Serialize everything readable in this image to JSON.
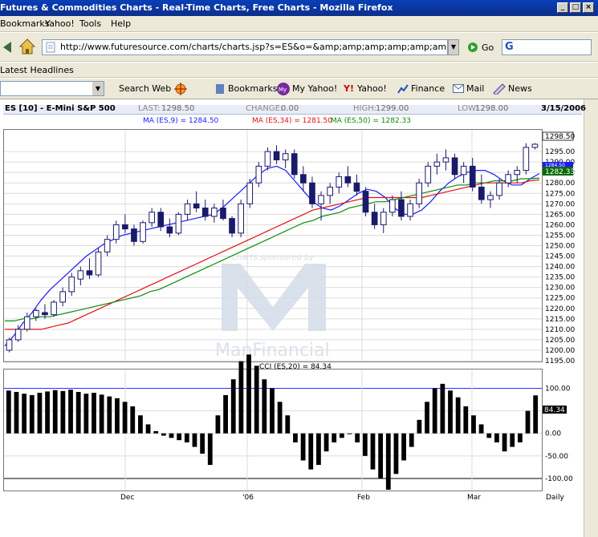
{
  "window": {
    "title": "Futures & Commodities Charts - Real-Time Charts, Free Charts - Mozilla Firefox"
  },
  "menu": [
    "Bookmarks",
    "Yahoo!",
    "Tools",
    "Help"
  ],
  "address": {
    "url": "http://www.futuresource.com/charts/charts.jsp?s=ES&o=&amp;amp;amp;amp;amp;amp;amp;amp;amp;amp;a=D&",
    "go_label": "Go"
  },
  "bookmarks_bar": {
    "item": "Latest Headlines"
  },
  "yahoo_toolbar": {
    "search_web": "Search Web",
    "bookmarks": "Bookmarks",
    "my_yahoo": "My Yahoo!",
    "yahoo": "Yahoo!",
    "finance": "Finance",
    "mail": "Mail",
    "news": "News"
  },
  "chart_header": {
    "symbol": "ES [10] - E-Mini S&P 500",
    "last_label": "LAST:",
    "last": "1298.50",
    "change_label": "CHANGE:",
    "change": "0.00",
    "high_label": "HIGH:",
    "high": "1299.00",
    "low_label": "LOW:",
    "low": "1298.00",
    "date": "3/15/2006"
  },
  "ma_legend": {
    "ma9": "MA (ES,9) = 1284.50",
    "ma34": "MA (ES,34) = 1281.50",
    "ma50": "MA (ES,50) = 1282.33"
  },
  "watermark": {
    "sponsor": "Charts sponsored by",
    "brand": "ManFinancial"
  },
  "cci_label": "CCI (ES,20) = 84.34",
  "price_badges": {
    "last": "1298.50",
    "ma9": "1284.50",
    "ma50": "1282.33"
  },
  "cci_badge": "84.34",
  "bottom_label": "Daily",
  "chart_data": [
    {
      "type": "candlestick",
      "title": "ES [10] - E-Mini S&P 500",
      "x": [
        "Dec",
        "'06",
        "Feb",
        "Mar"
      ],
      "ylim": [
        1195,
        1305
      ],
      "yticks": [
        "1295.00",
        "1290.00",
        "1285.00",
        "1280.00",
        "1275.00",
        "1270.00",
        "1265.00",
        "1260.00",
        "1255.00",
        "1250.00",
        "1245.00",
        "1240.00",
        "1235.00",
        "1230.00",
        "1225.00",
        "1220.00",
        "1215.00",
        "1210.00",
        "1205.00",
        "1200.00",
        "1195.00"
      ],
      "series": [
        {
          "name": "MA (ES,9)",
          "color": "#1a1aff",
          "values": [
            1202,
            1207,
            1213,
            1218,
            1224,
            1229,
            1233,
            1237,
            1241,
            1245,
            1248,
            1251,
            1253,
            1255,
            1256,
            1257,
            1258,
            1259,
            1260,
            1261,
            1262,
            1263,
            1264,
            1265,
            1268,
            1272,
            1276,
            1280,
            1284,
            1287,
            1288,
            1286,
            1281,
            1276,
            1271,
            1268,
            1267,
            1269,
            1272,
            1275,
            1277,
            1276,
            1273,
            1268,
            1265,
            1265,
            1267,
            1271,
            1276,
            1280,
            1283,
            1285,
            1286,
            1286,
            1284,
            1281,
            1279,
            1279,
            1282,
            1284.5
          ]
        },
        {
          "name": "MA (ES,34)",
          "color": "#e01010",
          "values": [
            1210,
            1210,
            1210,
            1210,
            1210,
            1211,
            1212,
            1213,
            1215,
            1217,
            1219,
            1221,
            1223,
            1225,
            1227,
            1229,
            1231,
            1233,
            1235,
            1237,
            1239,
            1241,
            1243,
            1245,
            1247,
            1249,
            1251,
            1253,
            1255,
            1257,
            1259,
            1261,
            1263,
            1265,
            1267,
            1268,
            1269,
            1270,
            1271,
            1272,
            1273,
            1273,
            1273,
            1273,
            1273,
            1273,
            1273,
            1274,
            1275,
            1276,
            1277,
            1278,
            1279,
            1280,
            1280,
            1280,
            1280,
            1280,
            1281,
            1281.5
          ]
        },
        {
          "name": "MA (ES,50)",
          "color": "#0a8a0a",
          "values": [
            1214,
            1214,
            1215,
            1215,
            1216,
            1216,
            1217,
            1218,
            1219,
            1220,
            1221,
            1222,
            1223,
            1224,
            1225,
            1226,
            1228,
            1229,
            1231,
            1233,
            1235,
            1237,
            1239,
            1241,
            1243,
            1245,
            1247,
            1249,
            1251,
            1253,
            1255,
            1257,
            1259,
            1261,
            1262,
            1264,
            1265,
            1266,
            1268,
            1269,
            1270,
            1271,
            1271,
            1272,
            1273,
            1274,
            1275,
            1276,
            1277,
            1278,
            1279,
            1279,
            1280,
            1280,
            1281,
            1281,
            1281,
            1282,
            1282,
            1282.33
          ]
        }
      ],
      "candles": [
        [
          1200,
          1206,
          1199,
          1205
        ],
        [
          1205,
          1212,
          1204,
          1210
        ],
        [
          1210,
          1218,
          1209,
          1216
        ],
        [
          1216,
          1220,
          1214,
          1219
        ],
        [
          1218,
          1222,
          1215,
          1217
        ],
        [
          1217,
          1224,
          1216,
          1223
        ],
        [
          1223,
          1230,
          1221,
          1228
        ],
        [
          1228,
          1237,
          1226,
          1235
        ],
        [
          1234,
          1240,
          1231,
          1238
        ],
        [
          1238,
          1244,
          1234,
          1236
        ],
        [
          1236,
          1249,
          1235,
          1247
        ],
        [
          1247,
          1255,
          1245,
          1253
        ],
        [
          1253,
          1262,
          1251,
          1260
        ],
        [
          1260,
          1265,
          1256,
          1258
        ],
        [
          1258,
          1260,
          1250,
          1252
        ],
        [
          1252,
          1262,
          1251,
          1261
        ],
        [
          1261,
          1268,
          1259,
          1266
        ],
        [
          1266,
          1268,
          1257,
          1259
        ],
        [
          1259,
          1263,
          1254,
          1256
        ],
        [
          1256,
          1266,
          1255,
          1265
        ],
        [
          1265,
          1272,
          1262,
          1270
        ],
        [
          1270,
          1276,
          1266,
          1268
        ],
        [
          1268,
          1272,
          1262,
          1264
        ],
        [
          1264,
          1270,
          1261,
          1268
        ],
        [
          1268,
          1272,
          1262,
          1263
        ],
        [
          1263,
          1264,
          1254,
          1256
        ],
        [
          1256,
          1272,
          1254,
          1270
        ],
        [
          1270,
          1282,
          1268,
          1280
        ],
        [
          1280,
          1290,
          1278,
          1288
        ],
        [
          1288,
          1297,
          1286,
          1295
        ],
        [
          1295,
          1298,
          1289,
          1291
        ],
        [
          1291,
          1296,
          1287,
          1294
        ],
        [
          1294,
          1296,
          1282,
          1284
        ],
        [
          1284,
          1288,
          1276,
          1280
        ],
        [
          1280,
          1283,
          1268,
          1270
        ],
        [
          1270,
          1276,
          1262,
          1274
        ],
        [
          1274,
          1280,
          1270,
          1278
        ],
        [
          1278,
          1285,
          1275,
          1283
        ],
        [
          1283,
          1288,
          1278,
          1280
        ],
        [
          1280,
          1284,
          1274,
          1276
        ],
        [
          1276,
          1278,
          1264,
          1266
        ],
        [
          1266,
          1270,
          1258,
          1260
        ],
        [
          1260,
          1268,
          1256,
          1266
        ],
        [
          1266,
          1274,
          1264,
          1272
        ],
        [
          1272,
          1276,
          1262,
          1264
        ],
        [
          1264,
          1272,
          1262,
          1270
        ],
        [
          1270,
          1282,
          1268,
          1280
        ],
        [
          1280,
          1290,
          1278,
          1288
        ],
        [
          1288,
          1294,
          1284,
          1290
        ],
        [
          1290,
          1296,
          1286,
          1292
        ],
        [
          1292,
          1294,
          1282,
          1284
        ],
        [
          1284,
          1290,
          1280,
          1288
        ],
        [
          1288,
          1292,
          1276,
          1278
        ],
        [
          1278,
          1284,
          1270,
          1272
        ],
        [
          1272,
          1276,
          1268,
          1274
        ],
        [
          1274,
          1282,
          1272,
          1280
        ],
        [
          1280,
          1286,
          1278,
          1284
        ],
        [
          1284,
          1288,
          1280,
          1286
        ],
        [
          1286,
          1299,
          1284,
          1297
        ],
        [
          1297,
          1299,
          1296,
          1298.5
        ]
      ]
    },
    {
      "type": "bar",
      "title": "CCI (ES,20) = 84.34",
      "ylim": [
        -125,
        140
      ],
      "yticks": [
        "100.00",
        "50.00",
        "0.00",
        "-50.00",
        "-100.00"
      ],
      "values": [
        95,
        92,
        88,
        85,
        90,
        93,
        96,
        94,
        97,
        92,
        88,
        90,
        86,
        82,
        78,
        70,
        60,
        40,
        20,
        5,
        -5,
        -10,
        -15,
        -20,
        -30,
        -45,
        -70,
        40,
        85,
        120,
        160,
        175,
        150,
        120,
        100,
        70,
        40,
        -20,
        -60,
        -80,
        -70,
        -40,
        -20,
        -10,
        0,
        -20,
        -50,
        -80,
        -100,
        -125,
        -90,
        -60,
        -30,
        30,
        70,
        100,
        110,
        95,
        80,
        60,
        40,
        20,
        -10,
        -20,
        -40,
        -30,
        -20,
        50,
        84.34
      ]
    }
  ]
}
